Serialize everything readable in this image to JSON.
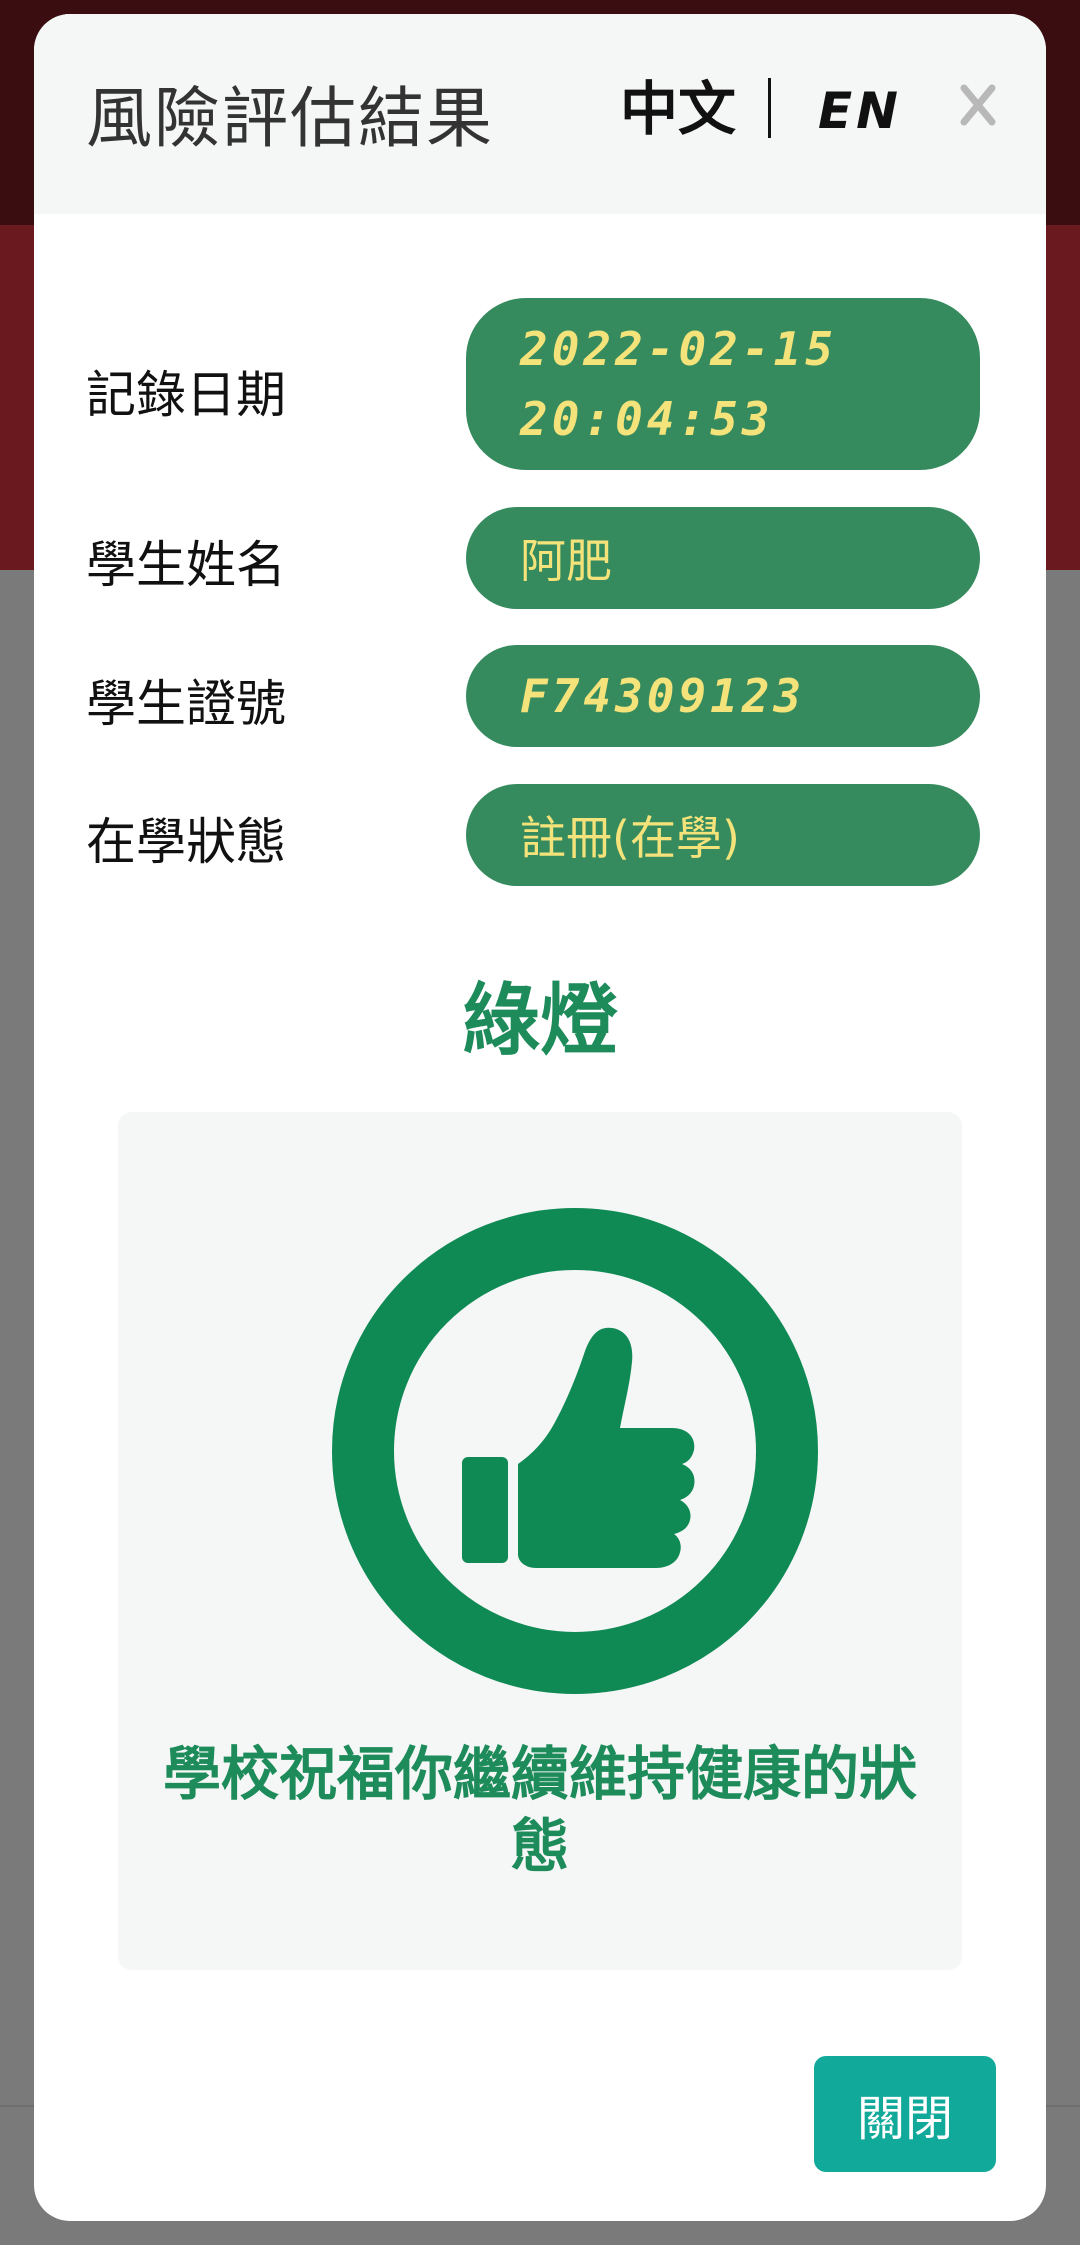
{
  "modal": {
    "title": "風險評估結果",
    "lang_zh": "中文",
    "lang_en": "EN",
    "close_icon": "close-icon"
  },
  "info": {
    "record_date_label": "記錄日期",
    "record_date_value": "2022-02-15",
    "record_time_value": "20:04:53",
    "student_name_label": "學生姓名",
    "student_name_value": "阿肥",
    "student_id_label": "學生證號",
    "student_id_value": "F74309123",
    "enrollment_label": "在學狀態",
    "enrollment_value": "註冊(在學)"
  },
  "result": {
    "status": "綠燈",
    "icon": "thumbs-up-icon",
    "message": "學校祝福你繼續維持健康的狀態"
  },
  "footer": {
    "close_button_label": "關閉"
  },
  "colors": {
    "pill_bg": "#368b5e",
    "pill_text": "#f4e27a",
    "status_green": "#1d8b5a",
    "button_teal": "#10a99a"
  }
}
